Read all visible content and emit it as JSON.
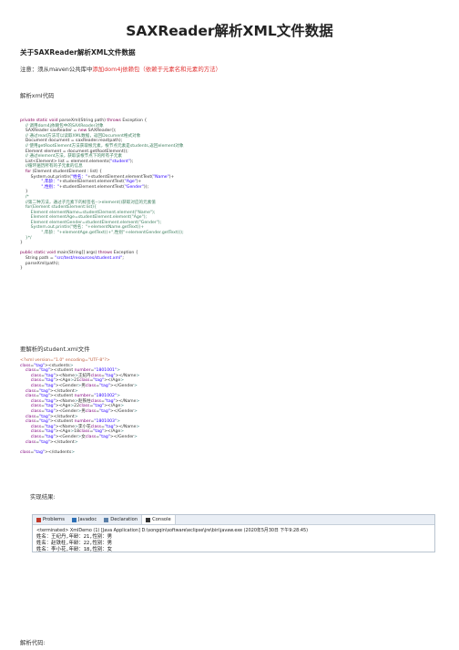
{
  "title": "SAXReader解析XML文件数据",
  "heading": "关于SAXReader解析XML文件数据",
  "note_prefix": "注意：须从maven公共库中",
  "note_highlight": "添加dom4j依赖包（依赖于元素名和元素的方法）",
  "section_code": "解析xml代码",
  "java_lines": [
    "private static void parseXml(String path) throws Exception {",
    "    // 调用dom4j依赖包中的SAXReader对象",
    "    SAXReader saxReader = new SAXReader();",
    "    // 通过read方法可以读取XML数据，返回Document格式对象",
    "    Document document = saxReader.read(path);",
    "    // 使用getRootElement方法获取根元素，根节点元素是students,返回element对象",
    "    Element element = document.getRootElement();",
    "    // 通过element方法，获取该根节点下的所有子元素",
    "    List<Element> list = element.elements(\"student\");",
    "    //循环遍历所有的子元素的信息",
    "    for (Element studentElement : list) {",
    "        System.out.println(\"姓名：\"+studentElement.elementText(\"Name\")+",
    "                \",年龄：\"+studentElement.elementText(\"Age\")+",
    "                \",性别：\"+studentElement.elementText(\"Gender\"));",
    "    }",
    "    /*",
    "    //第二种方法，通过子元素下的标签名-->element()获取对应的元素值",
    "    for(Element studentElement:list){",
    "        Element elementName=studentElement.element(\"Name\");",
    "        Element elementAge=studentElement.element(\"Age\");",
    "        Element elementGender=studentElement.element(\"Gender\");",
    "        System.out.println(\"姓名：\"+elementName.getText()+",
    "                \",年龄：\"+elementAge.getText()+\",性别\"+elementGender.getText());",
    "    }*/",
    "}",
    "",
    "public static void main(String[] args) throws Exception {",
    "    String path = \"src/test/resources/student.xml\";",
    "    parseXml(path);",
    "}"
  ],
  "section_xml": "要解析的student.xml文件",
  "xml_lines": [
    "<?xml version=\"1.0\" encoding=\"UTF-8\"?>",
    "<students>",
    "    <student number=\"1801001\">",
    "        <Name>王纪丹</Name>",
    "        <Age>21</Age>",
    "        <Gender>男</Gender>",
    "    </student>",
    "    <student number=\"1801002\">",
    "        <Name>赵铁柱</Name>",
    "        <Age>22</Age>",
    "        <Gender>男</Gender>",
    "    </student>",
    "    <student number=\"1801003\">",
    "        <Name>李小花</Name>",
    "        <Age>18</Age>",
    "        <Gender>女</Gender>",
    "    </student>",
    "",
    "</students>"
  ],
  "section_result": "实现结果:",
  "eclipse": {
    "tabs": [
      {
        "label": "Problems",
        "icon": "problems-icon"
      },
      {
        "label": "Javadoc",
        "icon": "javadoc-icon"
      },
      {
        "label": "Declaration",
        "icon": "declaration-icon"
      },
      {
        "label": "Console",
        "icon": "console-icon",
        "active": true
      }
    ],
    "terminated": "<terminated> XmlDemo (1) [Java Application] D:\\songqin\\software\\eclipse\\jre\\bin\\javaw.exe (2020年5月30日 下午9:28:45)",
    "output": [
      "姓名：王纪丹,年龄：21,性别：男",
      "姓名：赵铁柱,年龄：22,性别：男",
      "姓名：李小花,年龄：18,性别：女"
    ]
  },
  "section_bottom": "解析代码:",
  "colors": {
    "accent_red": "#e03030",
    "keyword": "#7f0055",
    "comment": "#3f7f5f",
    "string": "#2a00ff"
  }
}
